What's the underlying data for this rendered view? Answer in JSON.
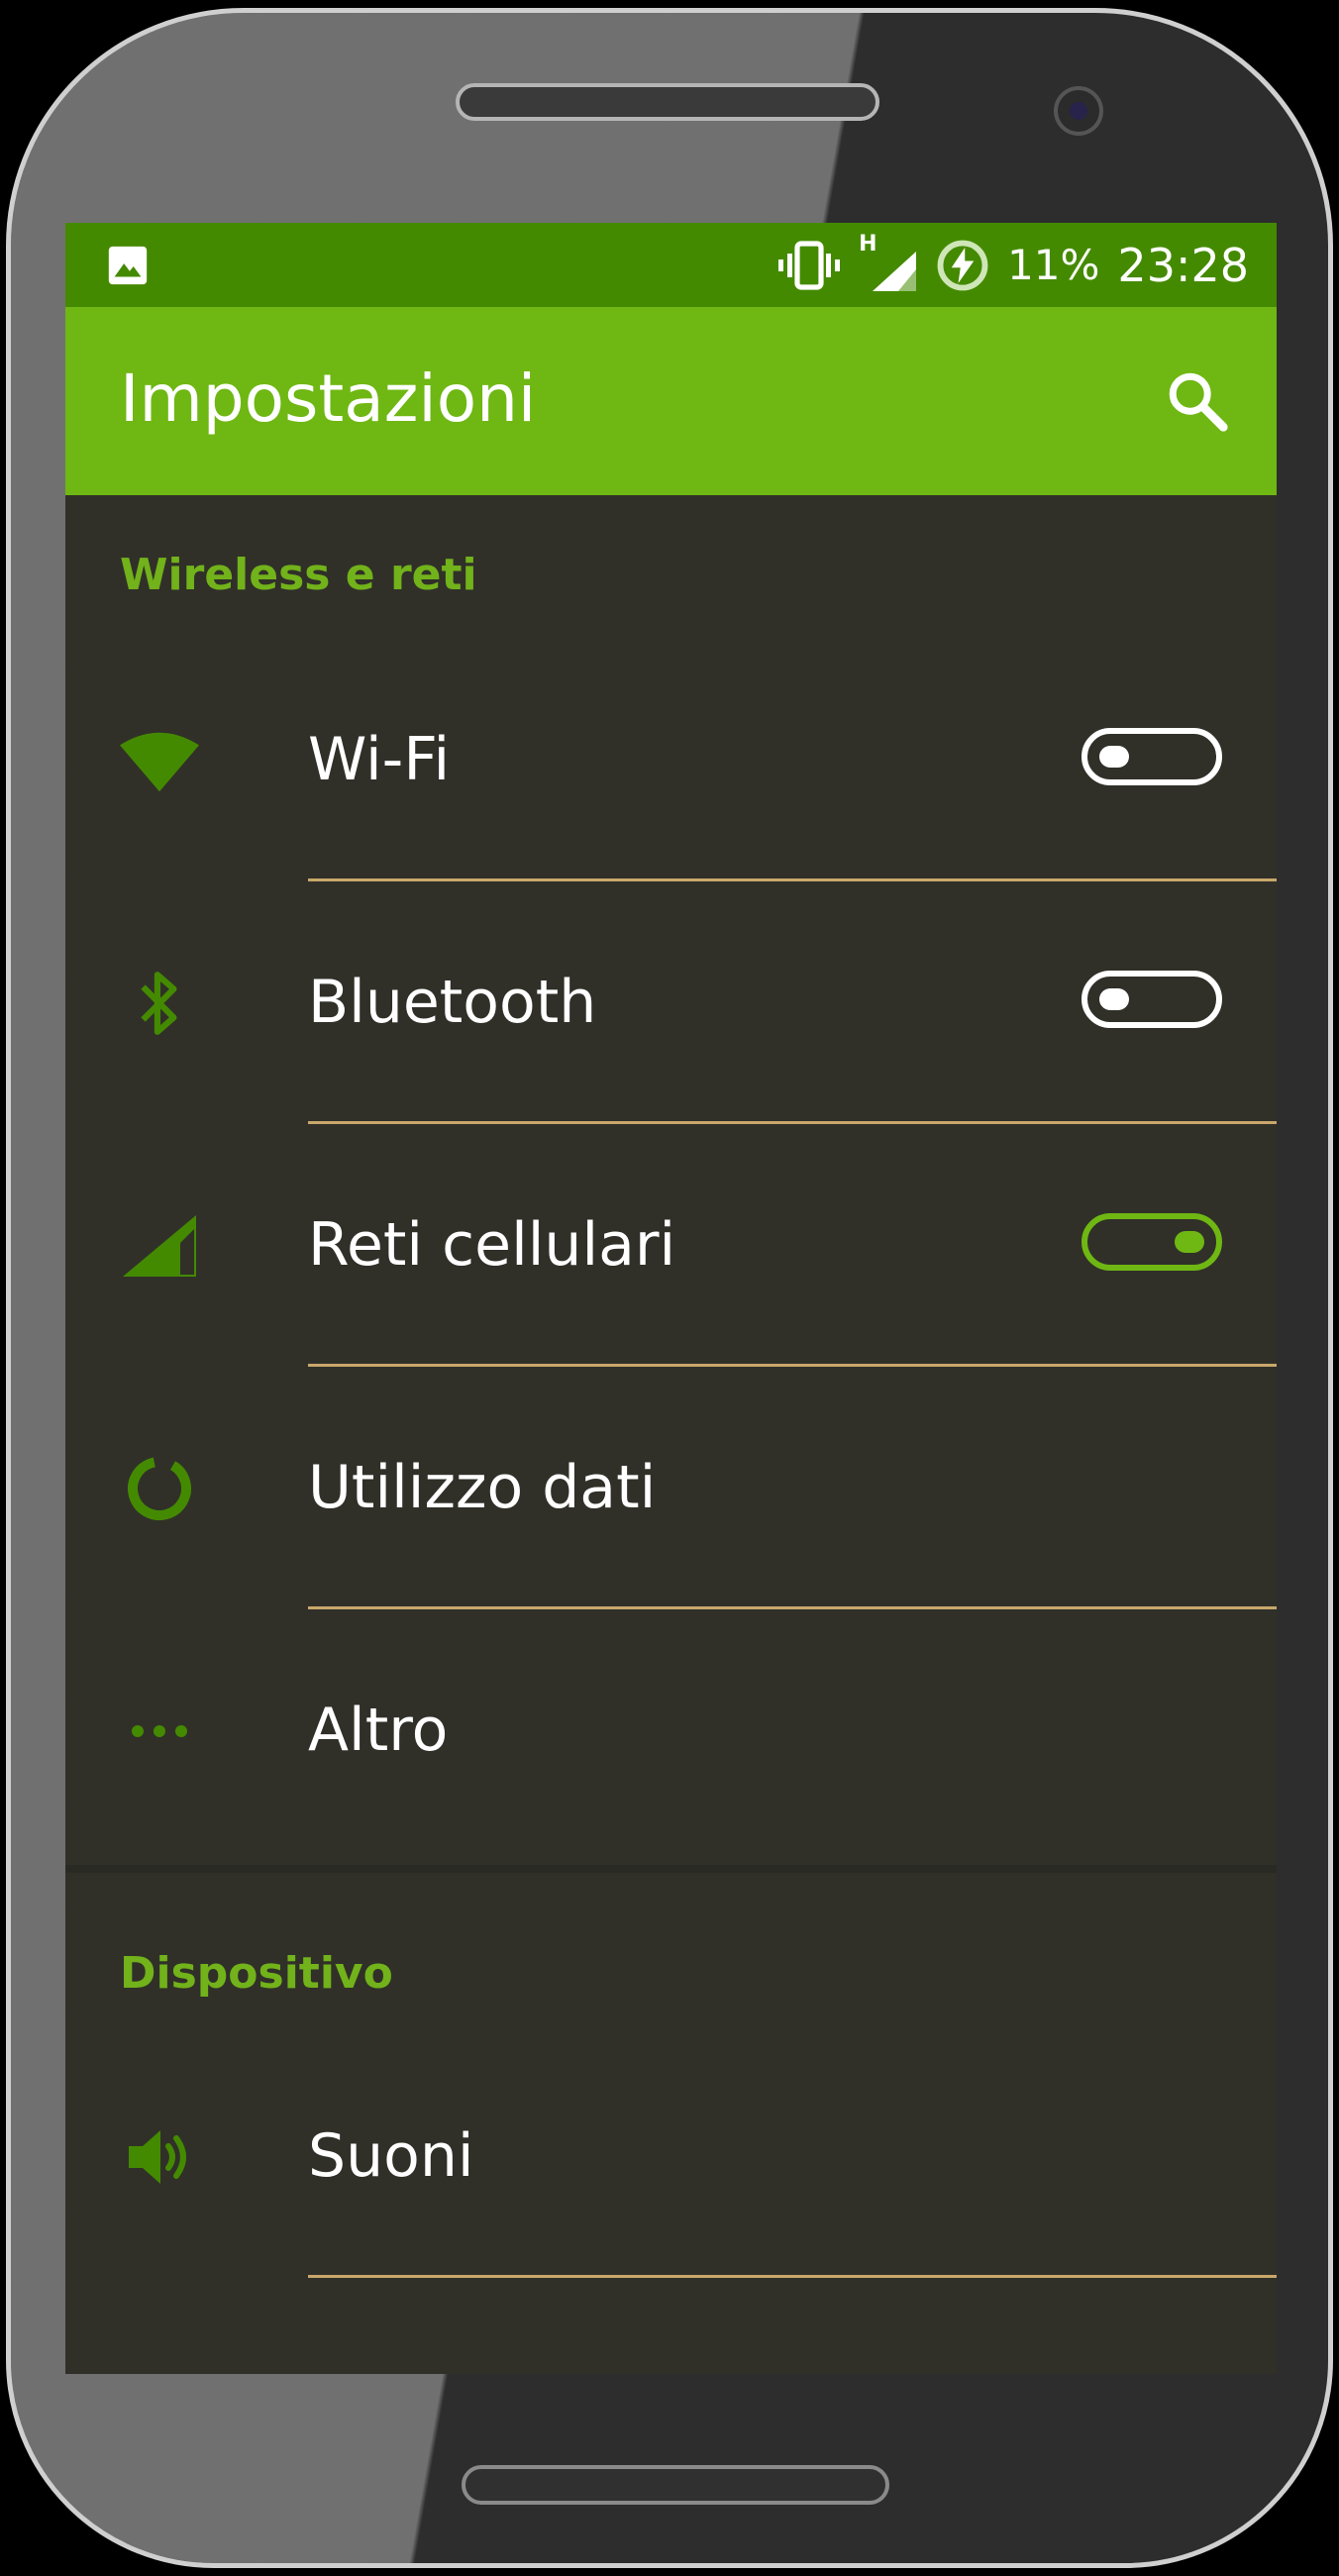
{
  "status_bar": {
    "battery_percent": "11%",
    "time": "23:28",
    "network_type": "H",
    "icons": [
      "image-notification-icon",
      "vibrate-icon",
      "signal-icon",
      "battery-charging-icon"
    ]
  },
  "app_bar": {
    "title": "Impostazioni",
    "search_icon": "search-icon"
  },
  "colors": {
    "status_bar": "#448a00",
    "app_bar": "#6fb713",
    "accent": "#72b21a",
    "background": "#303029",
    "divider": "#c9a76b"
  },
  "sections": [
    {
      "header": "Wireless e reti",
      "items": [
        {
          "label": "Wi-Fi",
          "icon": "wifi-icon",
          "toggle": "off"
        },
        {
          "label": "Bluetooth",
          "icon": "bluetooth-icon",
          "toggle": "off"
        },
        {
          "label": "Reti cellulari",
          "icon": "cellular-signal-icon",
          "toggle": "on"
        },
        {
          "label": "Utilizzo dati",
          "icon": "data-usage-icon"
        },
        {
          "label": "Altro",
          "icon": "more-icon"
        }
      ]
    },
    {
      "header": "Dispositivo",
      "items": [
        {
          "label": "Suoni",
          "icon": "volume-icon"
        }
      ]
    }
  ]
}
